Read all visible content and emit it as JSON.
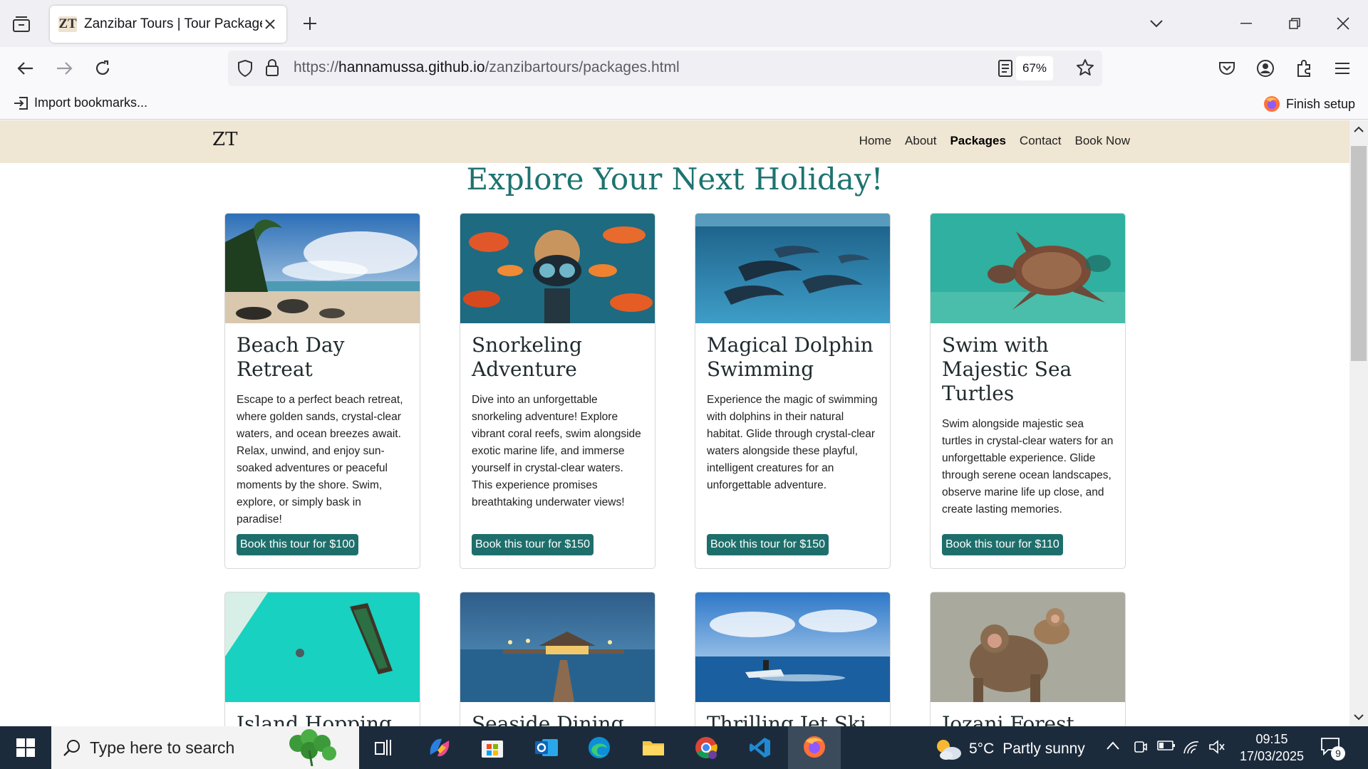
{
  "browser": {
    "tab_title": "Zanzibar Tours | Tour Packages",
    "tab_favicon_text": "ZT",
    "url_prefix": "https://",
    "url_host": "hannamussa.github.io",
    "url_path": "/zanzibartours/packages.html",
    "zoom": "67%",
    "bookmarks_import": "Import bookmarks...",
    "finish_setup": "Finish setup"
  },
  "site": {
    "logo": "ZT",
    "nav": [
      "Home",
      "About",
      "Packages",
      "Contact",
      "Book Now"
    ],
    "active_nav": "Packages",
    "headline": "Explore Your Next Holiday!"
  },
  "packages": [
    {
      "title": "Beach Day Retreat",
      "description": "Escape to a perfect beach retreat, where golden sands, crystal-clear waters, and ocean breezes await. Relax, unwind, and enjoy sun-soaked adventures or peaceful moments by the shore. Swim, explore, or simply bask in paradise!",
      "button": "Book this tour for $100",
      "image": "beach-palms"
    },
    {
      "title": "Snorkeling Adventure",
      "description": "Dive into an unforgettable snorkeling adventure! Explore vibrant coral reefs, swim alongside exotic marine life, and immerse yourself in crystal-clear waters. This experience promises breathtaking underwater views!",
      "button": "Book this tour for $150",
      "image": "snorkeler-fish"
    },
    {
      "title": "Magical Dolphin Swimming",
      "description": "Experience the magic of swimming with dolphins in their natural habitat. Glide through crystal-clear waters alongside these playful, intelligent creatures for an unforgettable adventure.",
      "button": "Book this tour for $150",
      "image": "dolphins"
    },
    {
      "title": "Swim with Majestic Sea Turtles",
      "description": "Swim alongside majestic sea turtles in crystal-clear waters for an unforgettable experience. Glide through serene ocean landscapes, observe marine life up close, and create lasting memories.",
      "button": "Book this tour for $110",
      "image": "sea-turtle"
    },
    {
      "title": "Island Hopping",
      "image": "boat-aerial"
    },
    {
      "title": "Seaside Dining",
      "image": "pier-restaurant"
    },
    {
      "title": "Thrilling Jet Ski",
      "image": "jet-ski"
    },
    {
      "title": "Jozani Forest",
      "image": "monkeys"
    }
  ],
  "taskbar": {
    "search_placeholder": "Type here to search",
    "weather_temp": "5°C",
    "weather_text": "Partly sunny",
    "time": "09:15",
    "date": "17/03/2025",
    "notifications": "9"
  },
  "colors": {
    "accent": "#1e7371",
    "button": "#1e6f6c",
    "site_nav_bg": "#efe6d3",
    "taskbar_bg": "#1c2b3c"
  }
}
